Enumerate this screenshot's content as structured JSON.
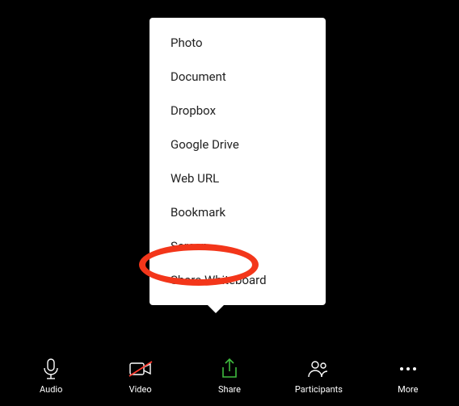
{
  "toolbar": {
    "audio_label": "Audio",
    "video_label": "Video",
    "share_label": "Share",
    "participants_label": "Participants",
    "more_label": "More"
  },
  "share_menu": {
    "items": [
      {
        "label": "Photo"
      },
      {
        "label": "Document"
      },
      {
        "label": "Dropbox"
      },
      {
        "label": "Google Drive"
      },
      {
        "label": "Web URL"
      },
      {
        "label": "Bookmark"
      },
      {
        "label": "Screen"
      },
      {
        "label": "Share Whiteboard"
      }
    ]
  },
  "colors": {
    "share_accent": "#3fbc3f",
    "annotation": "#f3361a"
  }
}
